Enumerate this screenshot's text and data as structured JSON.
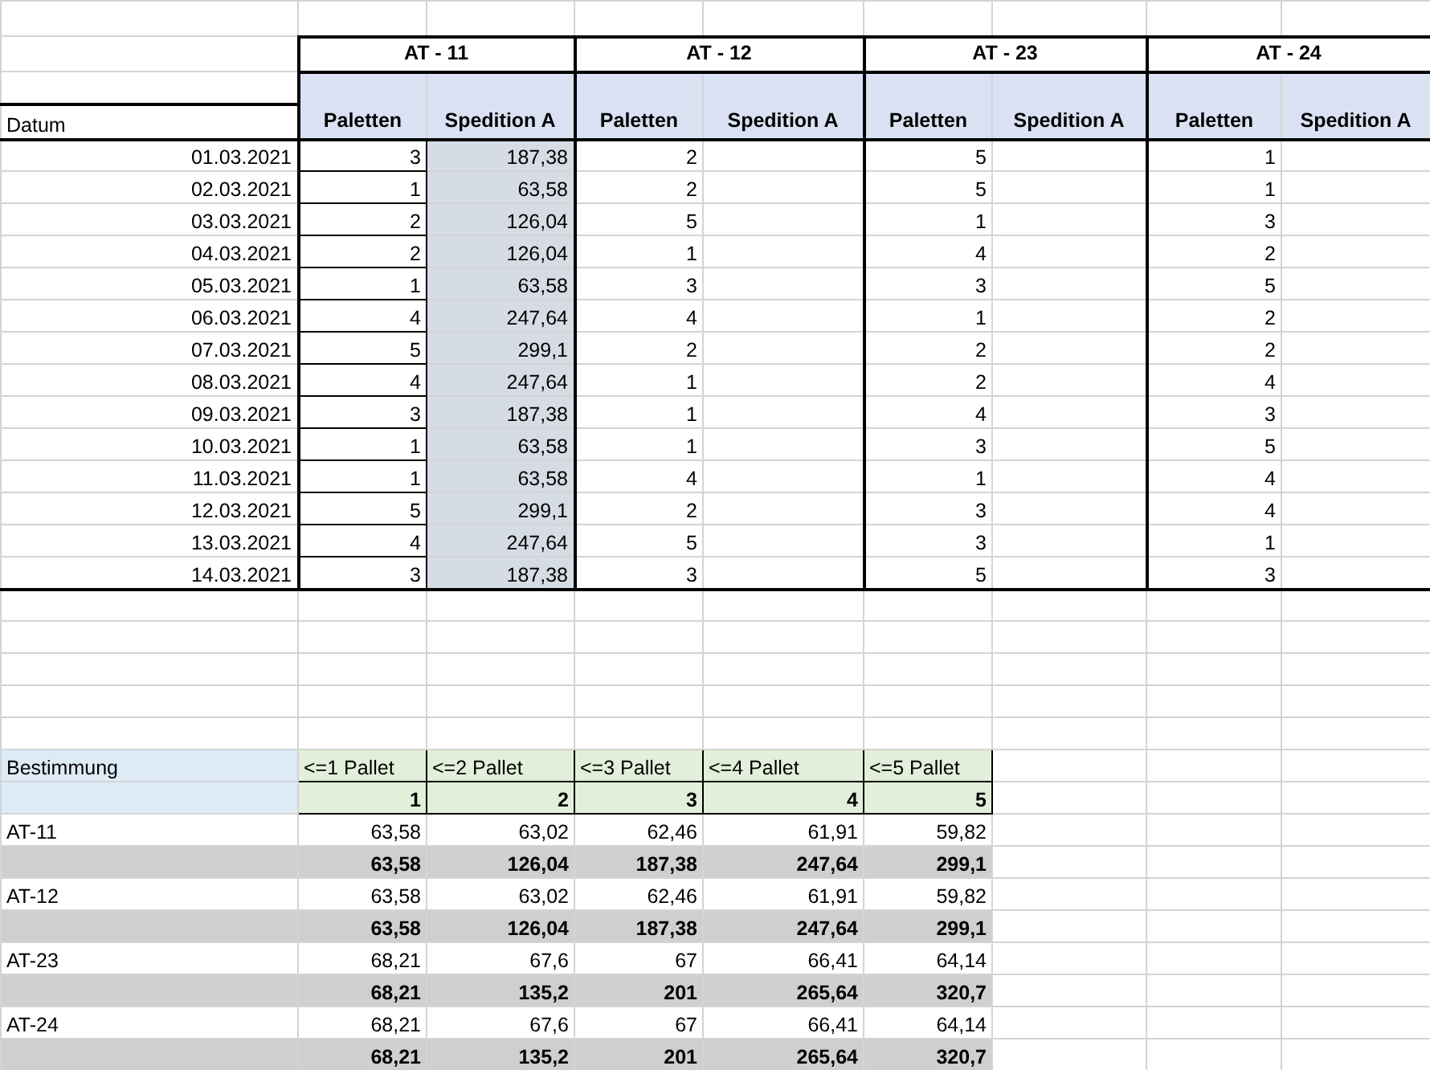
{
  "sheet": {
    "top_table": {
      "date_header": "Datum",
      "groups": [
        {
          "title": "AT - 11",
          "columns": [
            "Paletten",
            "Spedition A"
          ],
          "shaded": true
        },
        {
          "title": "AT - 12",
          "columns": [
            "Paletten",
            "Spedition A"
          ],
          "shaded": false
        },
        {
          "title": "AT - 23",
          "columns": [
            "Paletten",
            "Spedition A"
          ],
          "shaded": false
        },
        {
          "title": "AT - 24",
          "columns": [
            "Paletten",
            "Spedition A"
          ],
          "shaded": false
        }
      ],
      "rows": [
        {
          "date": "01.03.2021",
          "values": [
            {
              "paletten": "3",
              "spedition": "187,38"
            },
            {
              "paletten": "2"
            },
            {
              "paletten": "5"
            },
            {
              "paletten": "1"
            }
          ]
        },
        {
          "date": "02.03.2021",
          "values": [
            {
              "paletten": "1",
              "spedition": "63,58"
            },
            {
              "paletten": "2"
            },
            {
              "paletten": "5"
            },
            {
              "paletten": "1"
            }
          ]
        },
        {
          "date": "03.03.2021",
          "values": [
            {
              "paletten": "2",
              "spedition": "126,04"
            },
            {
              "paletten": "5"
            },
            {
              "paletten": "1"
            },
            {
              "paletten": "3"
            }
          ]
        },
        {
          "date": "04.03.2021",
          "values": [
            {
              "paletten": "2",
              "spedition": "126,04"
            },
            {
              "paletten": "1"
            },
            {
              "paletten": "4"
            },
            {
              "paletten": "2"
            }
          ]
        },
        {
          "date": "05.03.2021",
          "values": [
            {
              "paletten": "1",
              "spedition": "63,58"
            },
            {
              "paletten": "3"
            },
            {
              "paletten": "3"
            },
            {
              "paletten": "5"
            }
          ]
        },
        {
          "date": "06.03.2021",
          "values": [
            {
              "paletten": "4",
              "spedition": "247,64"
            },
            {
              "paletten": "4"
            },
            {
              "paletten": "1"
            },
            {
              "paletten": "2"
            }
          ]
        },
        {
          "date": "07.03.2021",
          "values": [
            {
              "paletten": "5",
              "spedition": "299,1"
            },
            {
              "paletten": "2"
            },
            {
              "paletten": "2"
            },
            {
              "paletten": "2"
            }
          ]
        },
        {
          "date": "08.03.2021",
          "values": [
            {
              "paletten": "4",
              "spedition": "247,64"
            },
            {
              "paletten": "1"
            },
            {
              "paletten": "2"
            },
            {
              "paletten": "4"
            }
          ]
        },
        {
          "date": "09.03.2021",
          "values": [
            {
              "paletten": "3",
              "spedition": "187,38"
            },
            {
              "paletten": "1"
            },
            {
              "paletten": "4"
            },
            {
              "paletten": "3"
            }
          ]
        },
        {
          "date": "10.03.2021",
          "values": [
            {
              "paletten": "1",
              "spedition": "63,58"
            },
            {
              "paletten": "1"
            },
            {
              "paletten": "3"
            },
            {
              "paletten": "5"
            }
          ]
        },
        {
          "date": "11.03.2021",
          "values": [
            {
              "paletten": "1",
              "spedition": "63,58"
            },
            {
              "paletten": "4"
            },
            {
              "paletten": "1"
            },
            {
              "paletten": "4"
            }
          ]
        },
        {
          "date": "12.03.2021",
          "values": [
            {
              "paletten": "5",
              "spedition": "299,1"
            },
            {
              "paletten": "2"
            },
            {
              "paletten": "3"
            },
            {
              "paletten": "4"
            }
          ]
        },
        {
          "date": "13.03.2021",
          "values": [
            {
              "paletten": "4",
              "spedition": "247,64"
            },
            {
              "paletten": "5"
            },
            {
              "paletten": "3"
            },
            {
              "paletten": "1"
            }
          ]
        },
        {
          "date": "14.03.2021",
          "values": [
            {
              "paletten": "3",
              "spedition": "187,38"
            },
            {
              "paletten": "3"
            },
            {
              "paletten": "5"
            },
            {
              "paletten": "3"
            }
          ]
        }
      ]
    },
    "bottom_table": {
      "header": "Bestimmung",
      "columns": [
        {
          "label": "<=1 Pallet",
          "number": "1"
        },
        {
          "label": "<=2 Pallet",
          "number": "2"
        },
        {
          "label": "<=3 Pallet",
          "number": "3"
        },
        {
          "label": "<=4 Pallet",
          "number": "4"
        },
        {
          "label": "<=5 Pallet",
          "number": "5"
        }
      ],
      "rows": [
        {
          "kind": "rate",
          "label": "AT-11",
          "values": [
            "63,58",
            "63,02",
            "62,46",
            "61,91",
            "59,82"
          ]
        },
        {
          "kind": "total",
          "values": [
            "63,58",
            "126,04",
            "187,38",
            "247,64",
            "299,1"
          ]
        },
        {
          "kind": "rate",
          "label": "AT-12",
          "values": [
            "63,58",
            "63,02",
            "62,46",
            "61,91",
            "59,82"
          ]
        },
        {
          "kind": "total",
          "values": [
            "63,58",
            "126,04",
            "187,38",
            "247,64",
            "299,1"
          ]
        },
        {
          "kind": "rate",
          "label": "AT-23",
          "values": [
            "68,21",
            "67,6",
            "67",
            "66,41",
            "64,14"
          ]
        },
        {
          "kind": "total",
          "values": [
            "68,21",
            "135,2",
            "201",
            "265,64",
            "320,7"
          ]
        },
        {
          "kind": "rate",
          "label": "AT-24",
          "values": [
            "68,21",
            "67,6",
            "67",
            "66,41",
            "64,14"
          ]
        },
        {
          "kind": "total",
          "values": [
            "68,21",
            "135,2",
            "201",
            "265,64",
            "320,7"
          ]
        }
      ]
    }
  }
}
